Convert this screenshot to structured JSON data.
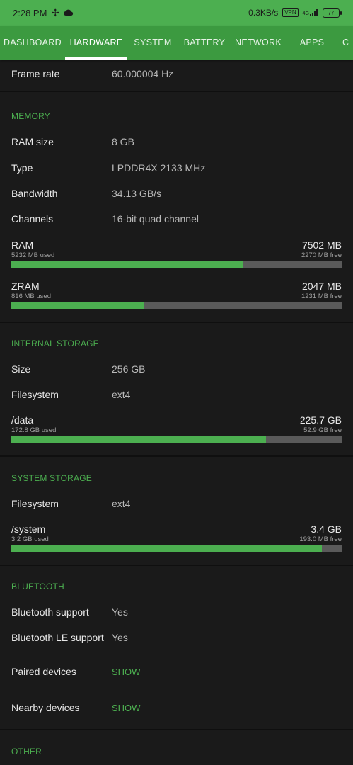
{
  "status": {
    "time": "2:28 PM",
    "net_speed": "0.3KB/s",
    "vpn": "VPN",
    "signal": "4G",
    "battery": "77"
  },
  "tabs": [
    "DASHBOARD",
    "HARDWARE",
    "SYSTEM",
    "BATTERY",
    "NETWORK",
    "APPS",
    "C"
  ],
  "display": {
    "frame_rate_label": "Frame rate",
    "frame_rate_value": "60.000004 Hz"
  },
  "memory": {
    "title": "MEMORY",
    "rows": [
      {
        "label": "RAM size",
        "value": "8 GB"
      },
      {
        "label": "Type",
        "value": "LPDDR4X 2133 MHz"
      },
      {
        "label": "Bandwidth",
        "value": "34.13 GB/s"
      },
      {
        "label": "Channels",
        "value": "16-bit quad channel"
      }
    ],
    "ram": {
      "name": "RAM",
      "total": "7502 MB",
      "used": "5232 MB used",
      "free": "2270 MB free",
      "fraction": 0.7
    },
    "zram": {
      "name": "ZRAM",
      "total": "2047 MB",
      "used": "816 MB used",
      "free": "1231 MB free",
      "fraction": 0.4
    }
  },
  "internal": {
    "title": "INTERNAL STORAGE",
    "rows": [
      {
        "label": "Size",
        "value": "256 GB"
      },
      {
        "label": "Filesystem",
        "value": "ext4"
      }
    ],
    "data": {
      "name": "/data",
      "total": "225.7 GB",
      "used": "172.8 GB used",
      "free": "52.9 GB free",
      "fraction": 0.77
    }
  },
  "system_storage": {
    "title": "SYSTEM STORAGE",
    "rows": [
      {
        "label": "Filesystem",
        "value": "ext4"
      }
    ],
    "system": {
      "name": "/system",
      "total": "3.4 GB",
      "used": "3.2 GB used",
      "free": "193.0 MB free",
      "fraction": 0.94
    }
  },
  "bluetooth": {
    "title": "BLUETOOTH",
    "rows": [
      {
        "label": "Bluetooth support",
        "value": "Yes"
      },
      {
        "label": "Bluetooth LE support",
        "value": "Yes"
      }
    ],
    "paired_label": "Paired devices",
    "paired_action": "SHOW",
    "nearby_label": "Nearby devices",
    "nearby_action": "SHOW"
  },
  "other": {
    "title": "OTHER"
  }
}
